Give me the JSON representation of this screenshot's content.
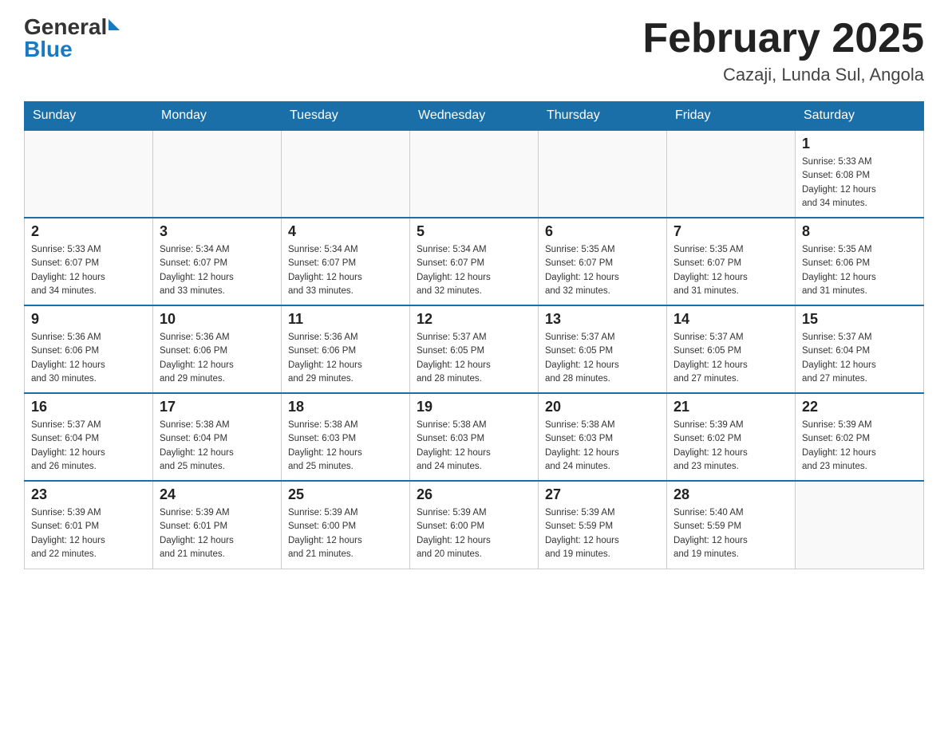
{
  "logo": {
    "general": "General",
    "blue": "Blue",
    "arrow": "▶"
  },
  "title": "February 2025",
  "subtitle": "Cazaji, Lunda Sul, Angola",
  "weekdays": [
    "Sunday",
    "Monday",
    "Tuesday",
    "Wednesday",
    "Thursday",
    "Friday",
    "Saturday"
  ],
  "weeks": [
    [
      {
        "day": "",
        "info": ""
      },
      {
        "day": "",
        "info": ""
      },
      {
        "day": "",
        "info": ""
      },
      {
        "day": "",
        "info": ""
      },
      {
        "day": "",
        "info": ""
      },
      {
        "day": "",
        "info": ""
      },
      {
        "day": "1",
        "info": "Sunrise: 5:33 AM\nSunset: 6:08 PM\nDaylight: 12 hours\nand 34 minutes."
      }
    ],
    [
      {
        "day": "2",
        "info": "Sunrise: 5:33 AM\nSunset: 6:07 PM\nDaylight: 12 hours\nand 34 minutes."
      },
      {
        "day": "3",
        "info": "Sunrise: 5:34 AM\nSunset: 6:07 PM\nDaylight: 12 hours\nand 33 minutes."
      },
      {
        "day": "4",
        "info": "Sunrise: 5:34 AM\nSunset: 6:07 PM\nDaylight: 12 hours\nand 33 minutes."
      },
      {
        "day": "5",
        "info": "Sunrise: 5:34 AM\nSunset: 6:07 PM\nDaylight: 12 hours\nand 32 minutes."
      },
      {
        "day": "6",
        "info": "Sunrise: 5:35 AM\nSunset: 6:07 PM\nDaylight: 12 hours\nand 32 minutes."
      },
      {
        "day": "7",
        "info": "Sunrise: 5:35 AM\nSunset: 6:07 PM\nDaylight: 12 hours\nand 31 minutes."
      },
      {
        "day": "8",
        "info": "Sunrise: 5:35 AM\nSunset: 6:06 PM\nDaylight: 12 hours\nand 31 minutes."
      }
    ],
    [
      {
        "day": "9",
        "info": "Sunrise: 5:36 AM\nSunset: 6:06 PM\nDaylight: 12 hours\nand 30 minutes."
      },
      {
        "day": "10",
        "info": "Sunrise: 5:36 AM\nSunset: 6:06 PM\nDaylight: 12 hours\nand 29 minutes."
      },
      {
        "day": "11",
        "info": "Sunrise: 5:36 AM\nSunset: 6:06 PM\nDaylight: 12 hours\nand 29 minutes."
      },
      {
        "day": "12",
        "info": "Sunrise: 5:37 AM\nSunset: 6:05 PM\nDaylight: 12 hours\nand 28 minutes."
      },
      {
        "day": "13",
        "info": "Sunrise: 5:37 AM\nSunset: 6:05 PM\nDaylight: 12 hours\nand 28 minutes."
      },
      {
        "day": "14",
        "info": "Sunrise: 5:37 AM\nSunset: 6:05 PM\nDaylight: 12 hours\nand 27 minutes."
      },
      {
        "day": "15",
        "info": "Sunrise: 5:37 AM\nSunset: 6:04 PM\nDaylight: 12 hours\nand 27 minutes."
      }
    ],
    [
      {
        "day": "16",
        "info": "Sunrise: 5:37 AM\nSunset: 6:04 PM\nDaylight: 12 hours\nand 26 minutes."
      },
      {
        "day": "17",
        "info": "Sunrise: 5:38 AM\nSunset: 6:04 PM\nDaylight: 12 hours\nand 25 minutes."
      },
      {
        "day": "18",
        "info": "Sunrise: 5:38 AM\nSunset: 6:03 PM\nDaylight: 12 hours\nand 25 minutes."
      },
      {
        "day": "19",
        "info": "Sunrise: 5:38 AM\nSunset: 6:03 PM\nDaylight: 12 hours\nand 24 minutes."
      },
      {
        "day": "20",
        "info": "Sunrise: 5:38 AM\nSunset: 6:03 PM\nDaylight: 12 hours\nand 24 minutes."
      },
      {
        "day": "21",
        "info": "Sunrise: 5:39 AM\nSunset: 6:02 PM\nDaylight: 12 hours\nand 23 minutes."
      },
      {
        "day": "22",
        "info": "Sunrise: 5:39 AM\nSunset: 6:02 PM\nDaylight: 12 hours\nand 23 minutes."
      }
    ],
    [
      {
        "day": "23",
        "info": "Sunrise: 5:39 AM\nSunset: 6:01 PM\nDaylight: 12 hours\nand 22 minutes."
      },
      {
        "day": "24",
        "info": "Sunrise: 5:39 AM\nSunset: 6:01 PM\nDaylight: 12 hours\nand 21 minutes."
      },
      {
        "day": "25",
        "info": "Sunrise: 5:39 AM\nSunset: 6:00 PM\nDaylight: 12 hours\nand 21 minutes."
      },
      {
        "day": "26",
        "info": "Sunrise: 5:39 AM\nSunset: 6:00 PM\nDaylight: 12 hours\nand 20 minutes."
      },
      {
        "day": "27",
        "info": "Sunrise: 5:39 AM\nSunset: 5:59 PM\nDaylight: 12 hours\nand 19 minutes."
      },
      {
        "day": "28",
        "info": "Sunrise: 5:40 AM\nSunset: 5:59 PM\nDaylight: 12 hours\nand 19 minutes."
      },
      {
        "day": "",
        "info": ""
      }
    ]
  ]
}
